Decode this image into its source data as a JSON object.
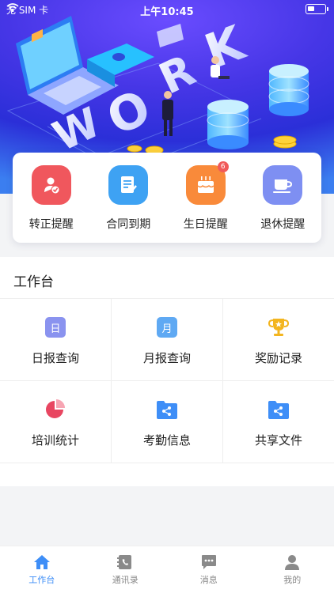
{
  "status_bar": {
    "carrier": "无 SIM 卡",
    "time": "上午10:45"
  },
  "reminders": [
    {
      "label": "转正提醒",
      "icon": "user-check-icon",
      "color": "#f0575d",
      "badge": ""
    },
    {
      "label": "合同到期",
      "icon": "contract-icon",
      "color": "#3ea2f3",
      "badge": ""
    },
    {
      "label": "生日提醒",
      "icon": "cake-icon",
      "color": "#f98a3a",
      "badge": "6"
    },
    {
      "label": "退休提醒",
      "icon": "coffee-cup-icon",
      "color": "#7e8ff2",
      "badge": ""
    }
  ],
  "workbench": {
    "title": "工作台",
    "items": [
      {
        "label": "日报查询",
        "icon_text": "日",
        "icon": "daily-report-icon",
        "color": "#8a93ef"
      },
      {
        "label": "月报查询",
        "icon_text": "月",
        "icon": "monthly-report-icon",
        "color": "#5fa9f3"
      },
      {
        "label": "奖励记录",
        "icon": "trophy-icon",
        "color": "#f3b51f"
      },
      {
        "label": "培训统计",
        "icon": "pie-chart-icon",
        "color": "#e84661"
      },
      {
        "label": "考勤信息",
        "icon": "attendance-folder-icon",
        "color": "#3e8ef7"
      },
      {
        "label": "共享文件",
        "icon": "shared-folder-icon",
        "color": "#3e8ef7"
      }
    ]
  },
  "tabbar": [
    {
      "label": "工作台",
      "icon": "home-icon",
      "active": true
    },
    {
      "label": "通讯录",
      "icon": "contacts-icon",
      "active": false
    },
    {
      "label": "消息",
      "icon": "message-icon",
      "active": false
    },
    {
      "label": "我的",
      "icon": "profile-icon",
      "active": false
    }
  ],
  "colors": {
    "accent": "#3e8ef7",
    "inactive": "#8a8a8a"
  }
}
